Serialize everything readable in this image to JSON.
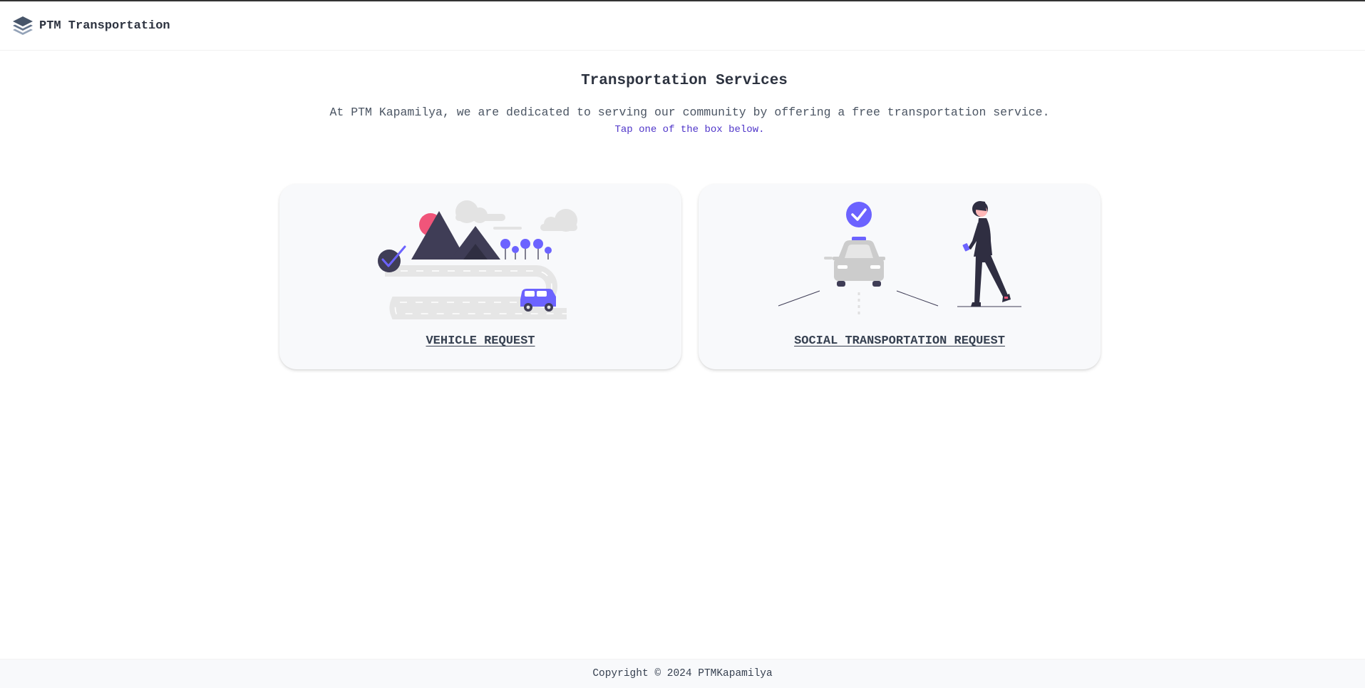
{
  "header": {
    "brand_title": "PTM Transportation",
    "brand_icon": "layers-icon"
  },
  "main": {
    "title": "Transportation Services",
    "intro": "At PTM Kapamilya, we are dedicated to serving our community by offering a free transportation service.",
    "tap_hint": "Tap one of the box below."
  },
  "cards": [
    {
      "label": "VEHICLE REQUEST",
      "illustration": "road-trip-illustration"
    },
    {
      "label": "SOCIAL TRANSPORTATION REQUEST",
      "illustration": "taxi-pickup-illustration"
    }
  ],
  "footer": {
    "copyright": "Copyright © 2024 PTMKapamilya"
  },
  "colors": {
    "accent": "#6c63ff",
    "dark": "#3f3d56",
    "pink": "#f0557a",
    "grey": "#e6e6e6",
    "text": "#374151"
  }
}
